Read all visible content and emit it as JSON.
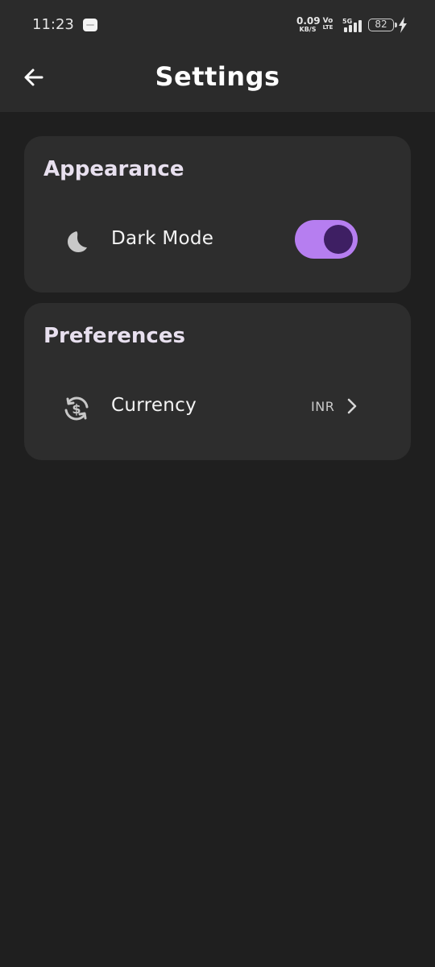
{
  "status_bar": {
    "time": "11:23",
    "net_speed_value": "0.09",
    "net_speed_unit": "KB/S",
    "volte_top": "Vo",
    "volte_bottom": "LTE",
    "network_type": "5G",
    "battery_level": "82",
    "icons": [
      "notification-app-icon",
      "signal-icon",
      "battery-icon",
      "charging-icon"
    ]
  },
  "app_bar": {
    "title": "Settings",
    "back_icon": "arrow-left-icon"
  },
  "sections": {
    "appearance": {
      "title": "Appearance",
      "dark_mode": {
        "label": "Dark Mode",
        "icon": "moon-icon",
        "enabled": true
      }
    },
    "preferences": {
      "title": "Preferences",
      "currency": {
        "label": "Currency",
        "value": "INR",
        "icon": "currency-exchange-icon",
        "trailing_icon": "chevron-right-icon"
      }
    }
  },
  "colors": {
    "background": "#1f1f1f",
    "app_bar": "#2b2b2b",
    "card": "#2d2d2d",
    "accent": "#b67ef0",
    "toggle_thumb": "#3e1f63"
  }
}
